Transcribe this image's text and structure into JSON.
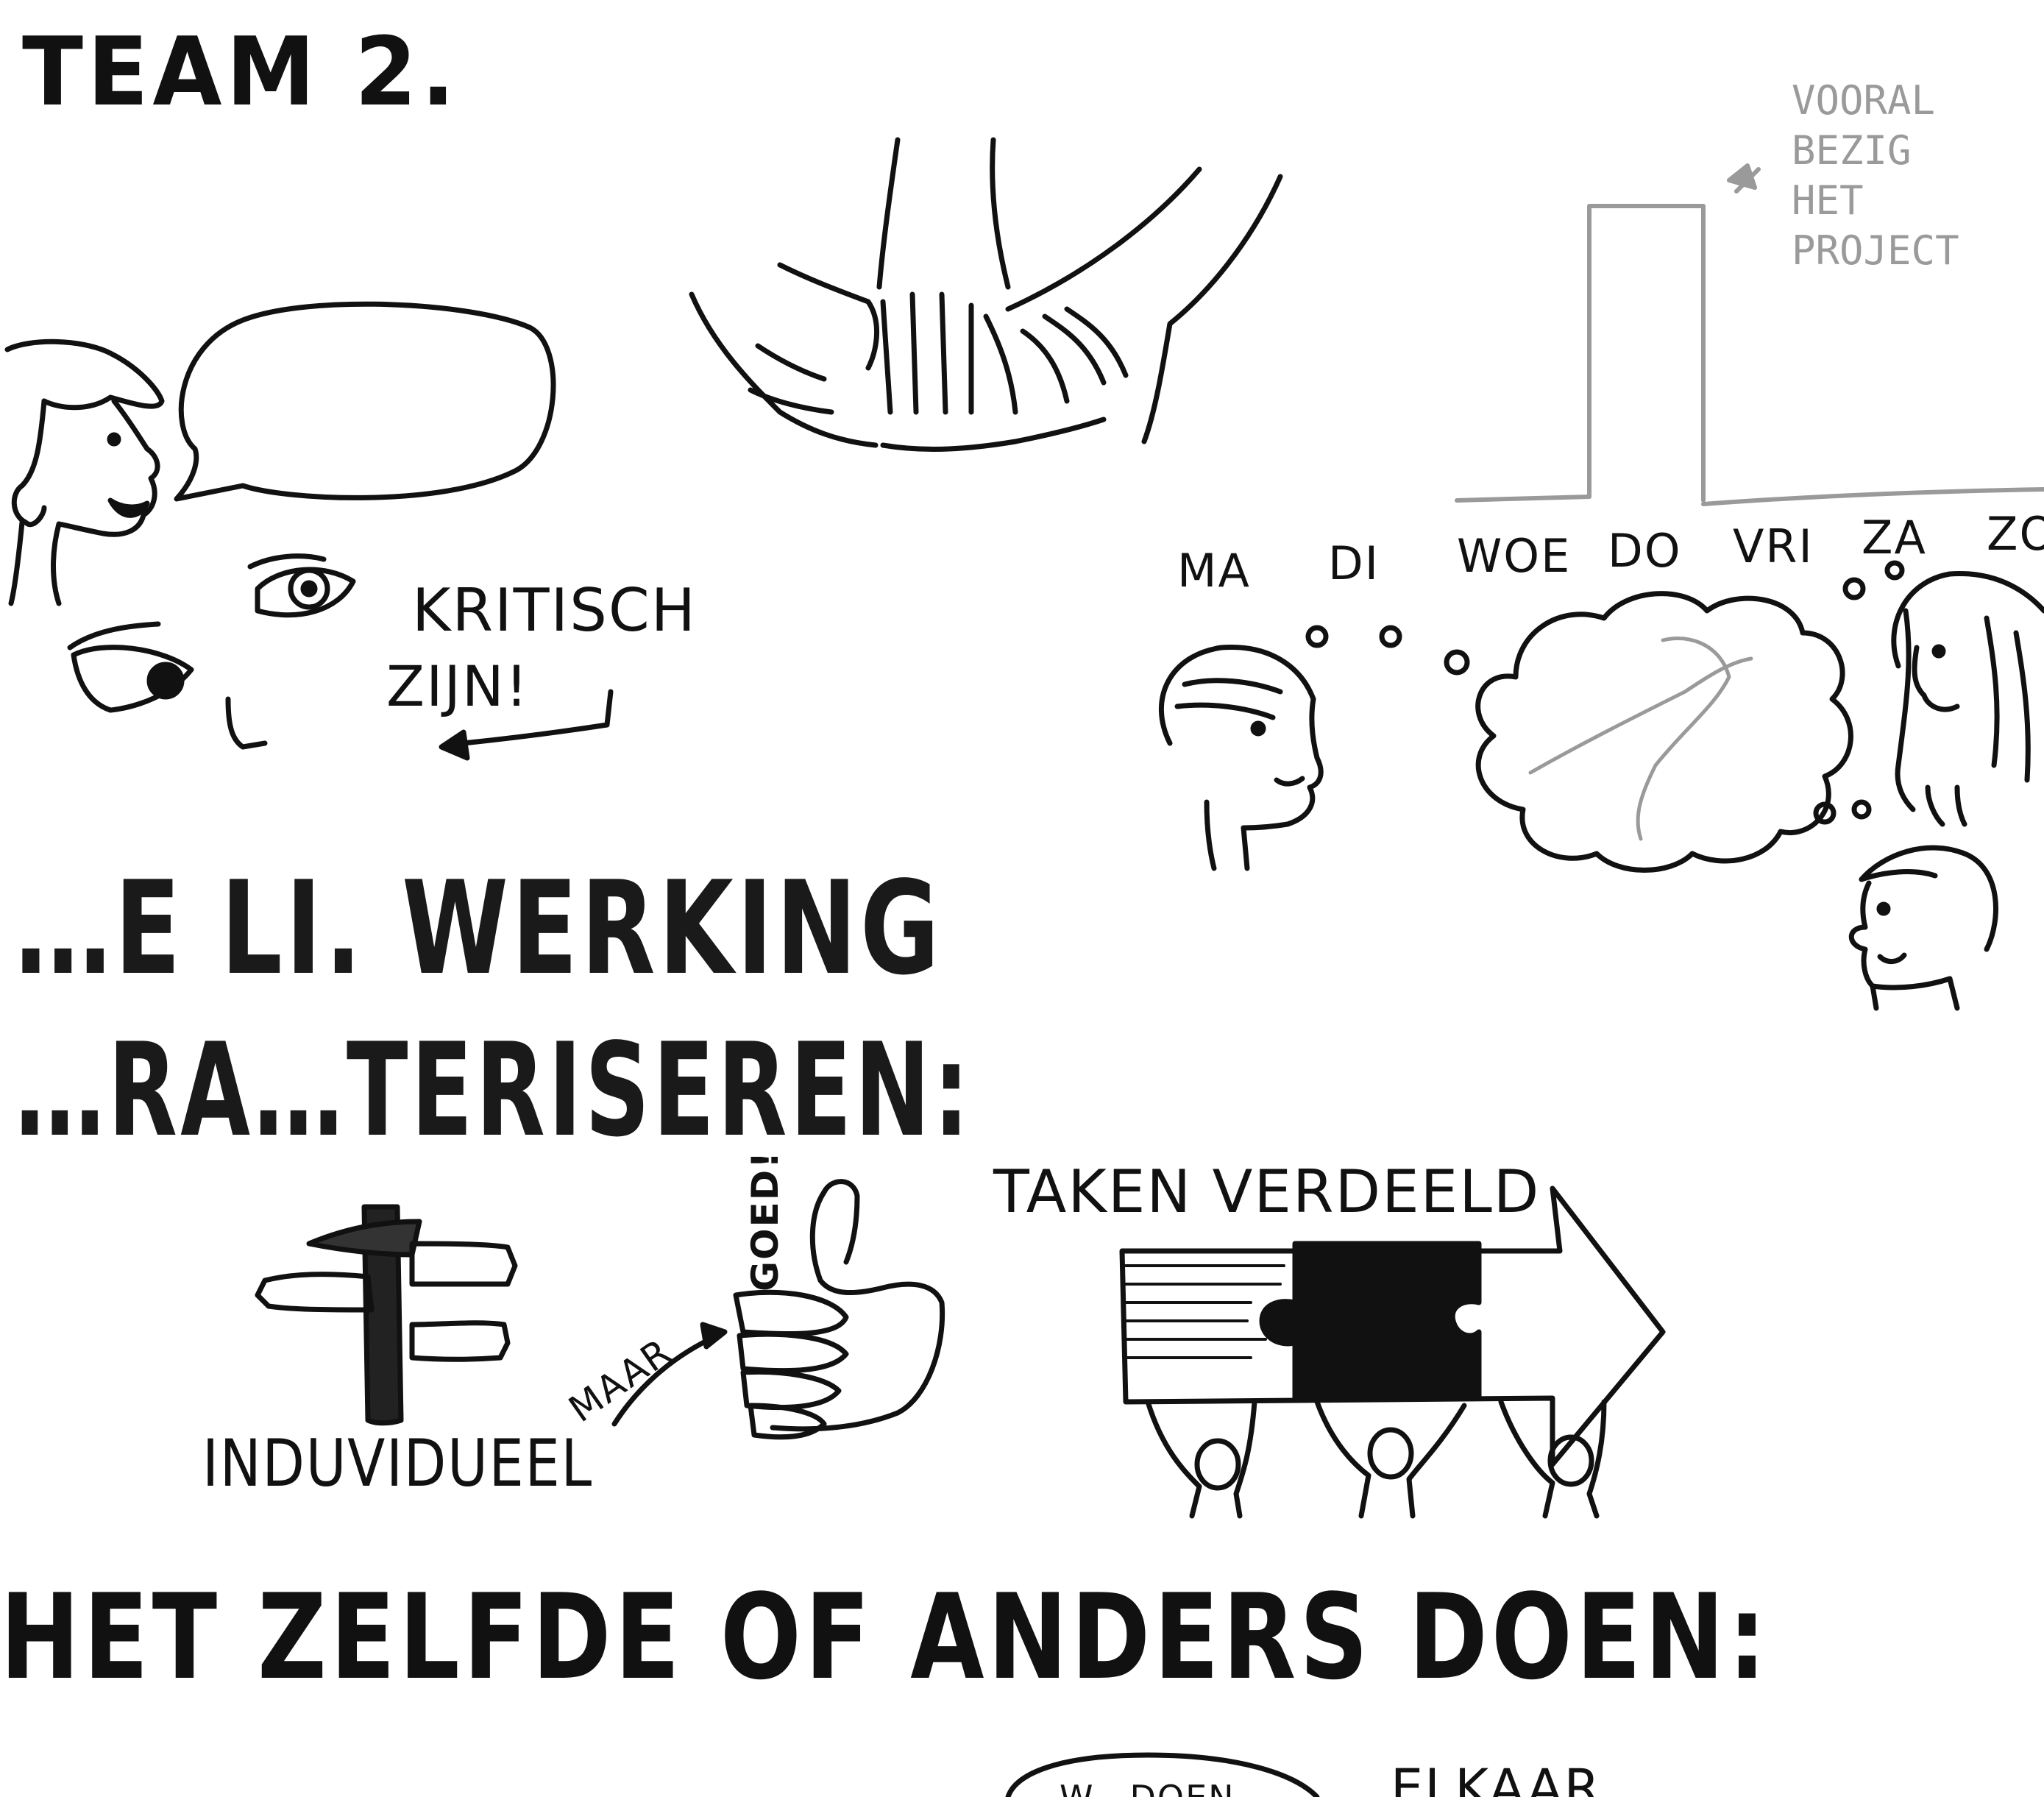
{
  "title": "TEAM 2.",
  "headings": {
    "collaboration_line1": "…E LI. WERKING",
    "collaboration_line2": "…RA…TERISEREN:",
    "same_or_different": "HET ZELFDE OF ANDERS DOEN:"
  },
  "notes": {
    "critical_line1": "KRITISCH",
    "critical_line2": "ZIJN!",
    "project_line1": "VOORAL",
    "project_line2": "BEZIG",
    "project_line3": "HET",
    "project_line4": "PROJECT",
    "tasks": "TAKEN VERDEELD",
    "individual": "INDUVIDUEEL",
    "but": "MAAR",
    "good": "GOED!",
    "bottom_right": "ELKAAR",
    "bottom_bubble": "W…DOEN"
  },
  "weekdays": [
    "MA",
    "DI",
    "WOE",
    "DO",
    "VRI",
    "ZA",
    "ZO"
  ],
  "colors": {
    "ink": "#111111",
    "faint_ink": "#9a9a9a",
    "paper": "#ffffff"
  },
  "icons": [
    "speaking-person-icon",
    "speech-bubble-icon",
    "eyes-icon",
    "arrow-left-icon",
    "joined-hands-icon",
    "bar-chart-icon",
    "thinking-person-icon",
    "thought-cloud-icon",
    "woman-icon",
    "man-icon",
    "signpost-icon",
    "thumbs-up-icon",
    "puzzle-arrow-icon",
    "team-lifting-icon"
  ]
}
